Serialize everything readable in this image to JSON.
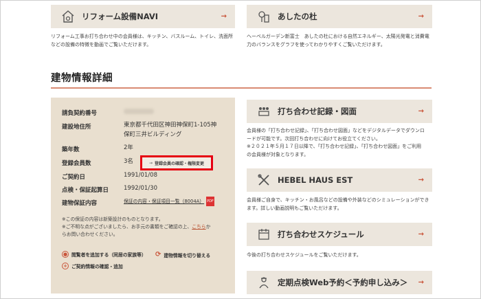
{
  "top_cards": [
    {
      "title": "リフォーム設備NAVI",
      "icon": "house-gear-icon",
      "desc_lines": [
        "リフォーム工事お打ち合わせ中の会員様は、キッチン、バスルーム、トイレ、洗面所",
        "などの設備の特徴を動画でご覧いただけます。"
      ]
    },
    {
      "title": "あしたの杜",
      "icon": "tree-building-icon",
      "desc_lines": [
        "ヘーベルガーデン新富士　あしたの杜における自然エネルギー、太陽光発電と消費電",
        "力のバランスをグラフを使ってわかりやすくご覧いただけます。"
      ]
    }
  ],
  "section_title": "建物情報詳細",
  "details": {
    "contract_no_label": "請負契約番号",
    "address_label": "建設地住所",
    "address_lines": [
      "東京都千代田区神田神保町1-105神",
      "保町三井ビルディング"
    ],
    "age_label": "築年数",
    "age_value": "2年",
    "members_label": "登録会員数",
    "members_value": "3名",
    "members_button": "登録会員の確認・権限変更",
    "contract_date_label": "ご契約日",
    "contract_date": "1991/01/08",
    "warranty_start_label": "点検・保証起算日",
    "warranty_start": "1992/01/30",
    "warranty_label": "建物保証内容",
    "warranty_link": "保証の内容・保証項目一覧（8004A）",
    "pdf_label": "PDF"
  },
  "notes": {
    "line1": "※この保証の内容は新築設計のものとなります。",
    "line2a": "※ご不明な点がございましたら、お手元の書類をご確認の上、",
    "line2_link": "こちら",
    "line2b": "か",
    "line3": "らお問い合わせください。"
  },
  "actions": {
    "add_viewer": "閲覧者を追加する（同居の家族等）",
    "switch_building": "建物情報を切り替える",
    "contract_confirm": "ご契約情報の確認・追加"
  },
  "right_cards": [
    {
      "title": "打ち合わせ記録・図面",
      "icon": "meeting-record-icon",
      "desc_lines": [
        "会員様の「打ち合わせ記録」、「打ち合わせ図面」などをデジタルデータでダウンロ",
        "ードが可能です。次回打ち合わせに向けてお役立てください。",
        "※２０２１年５月１７日以降で、「打ち合わせ記録」、「打ち合わせ図面」をご利用",
        "の会員様が対象となります。"
      ]
    },
    {
      "title": "HEBEL HAUS EST",
      "icon": "tools-icon",
      "desc_lines": [
        "会員様ご自身で、キッチン・お風呂などの設備や外装などのシミュレーションができ",
        "ます。詳しい動画説明もご覧いただけます。"
      ]
    },
    {
      "title": "打ち合わせスケジュール",
      "icon": "calendar-icon",
      "desc_lines": [
        "今後の打ち合わせスケジュールをご覧いただけます。"
      ]
    },
    {
      "title": "定期点検Web予約＜予約申し込み＞",
      "icon": "inspector-icon",
      "desc_lines": []
    }
  ],
  "arrow_glyph": "→",
  "accent_color": "#c9553a",
  "highlight_color": "#e60012"
}
